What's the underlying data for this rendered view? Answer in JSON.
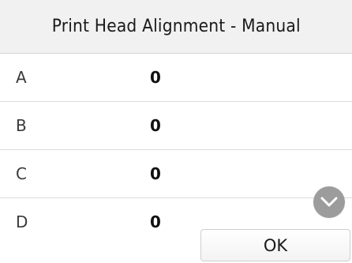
{
  "screen": {
    "title": "Print Head Alignment - Manual"
  },
  "rows": [
    {
      "label": "A",
      "value": "0"
    },
    {
      "label": "B",
      "value": "0"
    },
    {
      "label": "C",
      "value": "0"
    },
    {
      "label": "D",
      "value": "0"
    }
  ],
  "scroll": {
    "icon": "chevron-down-icon"
  },
  "actions": {
    "ok_label": "OK"
  },
  "colors": {
    "header_bg": "#f1f1f1",
    "scroll_button": "#9c9c9c",
    "divider": "#dcdcdc"
  }
}
